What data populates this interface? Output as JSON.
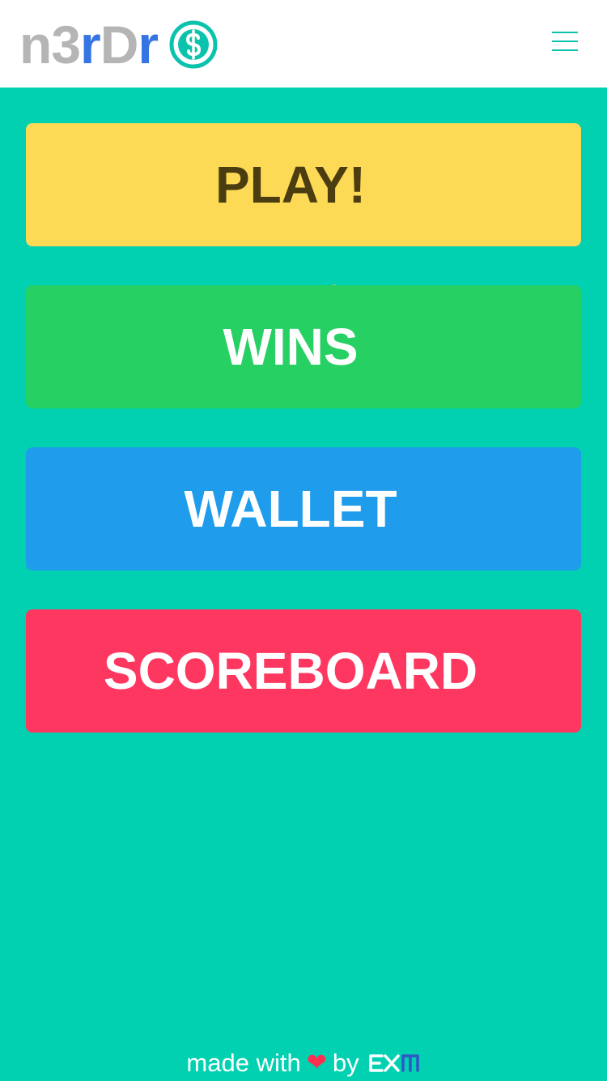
{
  "header": {
    "logo_part1": "n3",
    "logo_part2": "r",
    "logo_part3": "D",
    "logo_part4": "r",
    "menu_icon": "hamburger-menu-icon"
  },
  "menu": {
    "play": "PLAY!",
    "wins": "WINS",
    "wallet": "WALLET",
    "scoreboard": "SCOREBOARD"
  },
  "footer": {
    "made_with": "made with",
    "heart": "❤",
    "by": "by",
    "brand": "EXM"
  },
  "colors": {
    "background": "#02d1b1",
    "play": "#fdda55",
    "wins": "#26d063",
    "wallet": "#1f9cec",
    "scoreboard": "#fe3760",
    "logo_gray": "#b5b5b5",
    "logo_blue": "#3574e3",
    "accent": "#0bc3ad"
  }
}
